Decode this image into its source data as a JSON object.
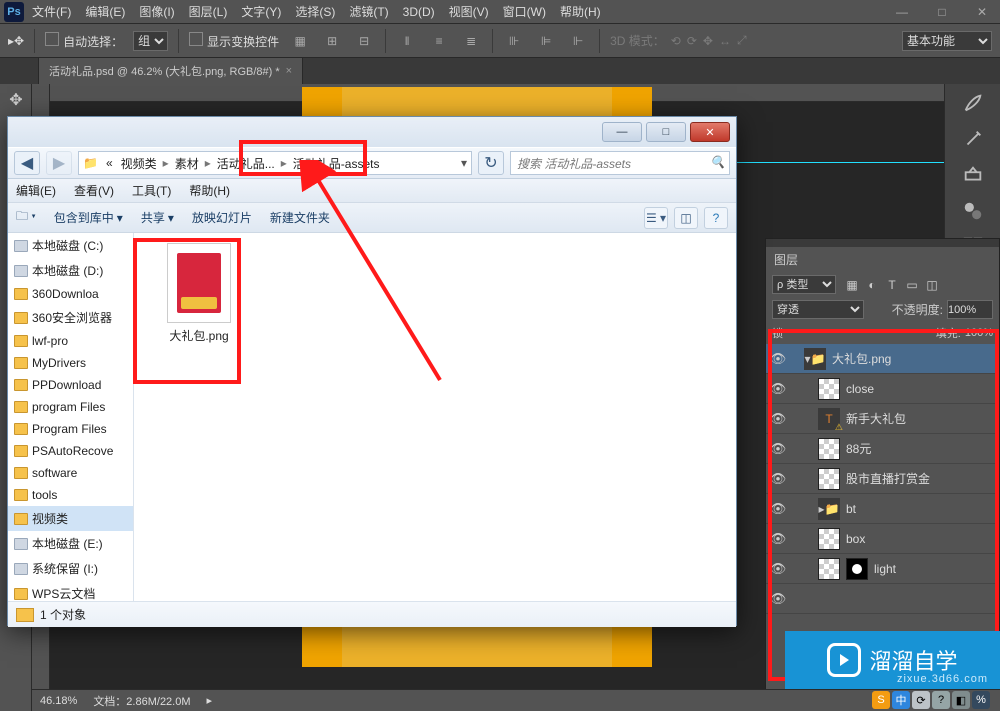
{
  "ps": {
    "menus": [
      "文件(F)",
      "编辑(E)",
      "图像(I)",
      "图层(L)",
      "文字(Y)",
      "选择(S)",
      "滤镜(T)",
      "3D(D)",
      "视图(V)",
      "窗口(W)",
      "帮助(H)"
    ],
    "options": {
      "auto_select": "自动选择：",
      "group": "组",
      "show_transform": "显示变换控件",
      "mode3d": "3D 模式：",
      "workspace": "基本功能"
    },
    "tab": "活动礼品.psd @ 46.2% (大礼包.png, RGB/8#) *",
    "status": {
      "zoom": "46.18%",
      "docsize": "文档：2.86M/22.0M"
    }
  },
  "explorer": {
    "crumbs": [
      "«",
      "视频类",
      "素材",
      "活动礼品...",
      "活动礼品-assets"
    ],
    "search_placeholder": "搜索 活动礼品-assets",
    "menus": [
      "编辑(E)",
      "查看(V)",
      "工具(T)",
      "帮助(H)"
    ],
    "toolbar": {
      "include": "包含到库中",
      "share": "共享",
      "slideshow": "放映幻灯片",
      "newfolder": "新建文件夹"
    },
    "sidebar": [
      {
        "label": "本地磁盘 (C:)",
        "type": "disk"
      },
      {
        "label": "本地磁盘 (D:)",
        "type": "disk"
      },
      {
        "label": "360Downloa",
        "type": "folder"
      },
      {
        "label": "360安全浏览器",
        "type": "folder"
      },
      {
        "label": "lwf-pro",
        "type": "folder"
      },
      {
        "label": "MyDrivers",
        "type": "folder"
      },
      {
        "label": "PPDownload",
        "type": "folder"
      },
      {
        "label": "program Files",
        "type": "folder"
      },
      {
        "label": "Program Files",
        "type": "folder"
      },
      {
        "label": "PSAutoRecove",
        "type": "folder"
      },
      {
        "label": "software",
        "type": "folder"
      },
      {
        "label": "tools",
        "type": "folder"
      },
      {
        "label": "视频类",
        "type": "folder",
        "sel": true
      },
      {
        "label": "本地磁盘 (E:)",
        "type": "disk"
      },
      {
        "label": "系统保留 (I:)",
        "type": "disk"
      },
      {
        "label": "WPS云文档",
        "type": "folder"
      }
    ],
    "file": "大礼包.png",
    "status": "1 个对象"
  },
  "layers": {
    "title": "图层",
    "kind": "ρ 类型",
    "blend": "穿透",
    "opacity_label": "不透明度:",
    "opacity": "100%",
    "lock_label": "锁",
    "fill_label": "填充:",
    "fill_value": "100%",
    "items": [
      {
        "name": "大礼包.png",
        "type": "group",
        "sel": true
      },
      {
        "name": "close",
        "type": "layer"
      },
      {
        "name": "新手大礼包",
        "type": "text"
      },
      {
        "name": "88元",
        "type": "layer"
      },
      {
        "name": "股市直播打赏金",
        "type": "layer"
      },
      {
        "name": "bt",
        "type": "groupc"
      },
      {
        "name": "box",
        "type": "layer"
      },
      {
        "name": "light",
        "type": "layermask"
      }
    ]
  },
  "wm": {
    "brand": "溜溜自学",
    "sub": "zixue.3d66.com"
  },
  "tray": [
    "S",
    "中",
    "⟳",
    "?",
    "◧",
    "%"
  ]
}
